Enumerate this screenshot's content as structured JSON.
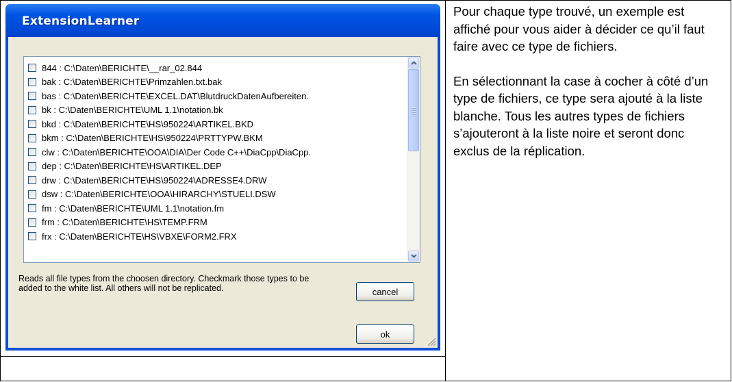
{
  "dialog": {
    "title": "ExtensionLearner",
    "file_types": [
      {
        "ext": "844",
        "path": "C:\\Daten\\BERICHTE\\__rar_02.844"
      },
      {
        "ext": "bak",
        "path": "C:\\Daten\\BERICHTE\\Primzahlen.txt.bak"
      },
      {
        "ext": "bas",
        "path": "C:\\Daten\\BERICHTE\\EXCEL.DAT\\BlutdruckDatenAufbereiten."
      },
      {
        "ext": "bk",
        "path": "C:\\Daten\\BERICHTE\\UML 1.1\\notation.bk"
      },
      {
        "ext": "bkd",
        "path": "C:\\Daten\\BERICHTE\\HS\\950224\\ARTIKEL.BKD"
      },
      {
        "ext": "bkm",
        "path": "C:\\Daten\\BERICHTE\\HS\\950224\\PRTTYPW.BKM"
      },
      {
        "ext": "clw",
        "path": "C:\\Daten\\BERICHTE\\OOA\\DIA\\Der Code C++\\DiaCpp\\DiaCpp."
      },
      {
        "ext": "dep",
        "path": "C:\\Daten\\BERICHTE\\HS\\ARTIKEL.DEP"
      },
      {
        "ext": "drw",
        "path": "C:\\Daten\\BERICHTE\\HS\\950224\\ADRESSE4.DRW"
      },
      {
        "ext": "dsw",
        "path": "C:\\Daten\\BERICHTE\\OOA\\HIRARCHY\\STUELI.DSW"
      },
      {
        "ext": "fm",
        "path": "C:\\Daten\\BERICHTE\\UML 1.1\\notation.fm"
      },
      {
        "ext": "frm",
        "path": "C:\\Daten\\BERICHTE\\HS\\TEMP.FRM"
      },
      {
        "ext": "frx",
        "path": "C:\\Daten\\BERICHTE\\HS\\VBXE\\FORM2.FRX"
      }
    ],
    "help_text": "Reads all file types from the choosen directory. Checkmark those types to be added to the white list. All others will not be replicated.",
    "cancel_label": "cancel",
    "ok_label": "ok"
  },
  "side": {
    "paragraph_1": "Pour chaque type trouvé, un exemple est affiché pour vous aider à décider ce qu’il faut faire avec ce type de fichiers.",
    "paragraph_2": "En sélectionnant la case à cocher à côté d’un type de fichiers, ce type sera ajouté à la liste blanche. Tous les autres types de fichiers s’ajouteront à la liste noire et seront donc exclus de la réplication."
  },
  "colors": {
    "titlebar": "#0054e3",
    "dialog_face": "#ece9d8"
  }
}
